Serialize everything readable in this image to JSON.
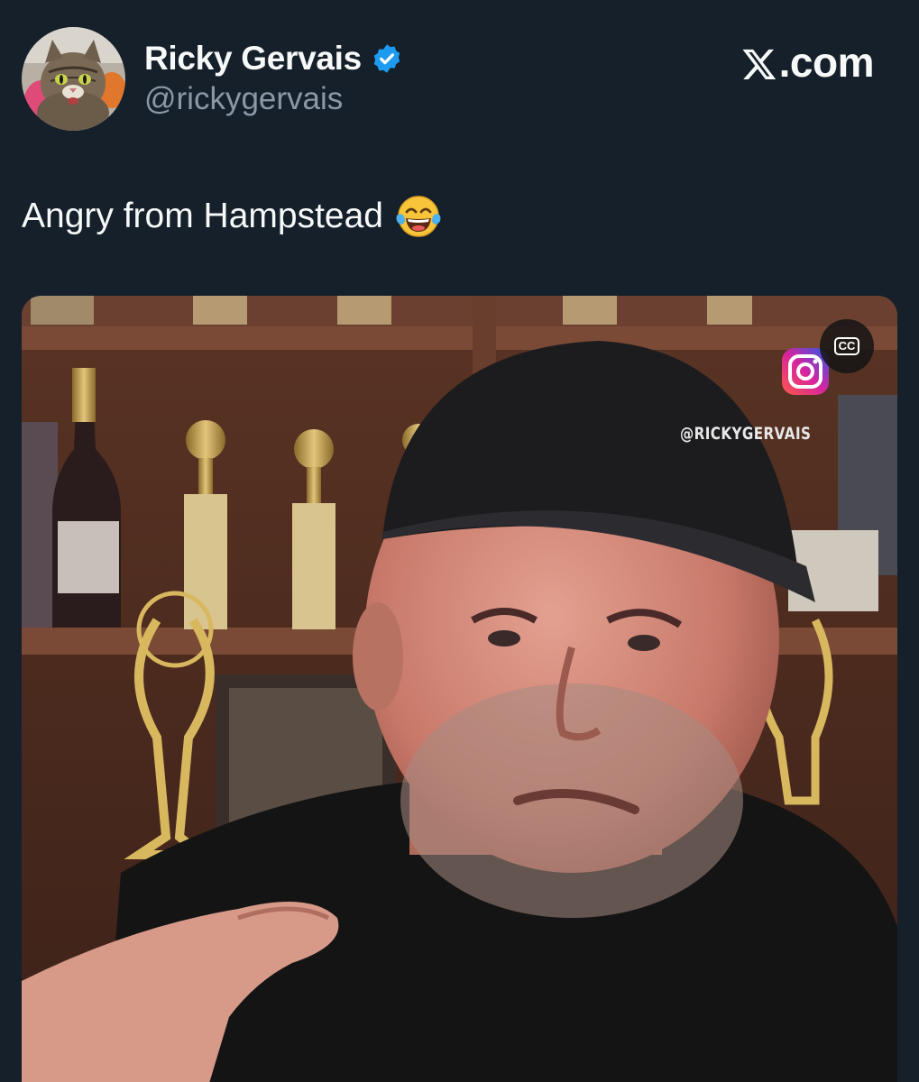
{
  "author": {
    "display_name": "Ricky Gervais",
    "handle": "@rickygervais",
    "verified": true,
    "avatar_icon": "cat-avatar"
  },
  "site": {
    "label": ".com",
    "logo_icon": "x-logo-icon"
  },
  "tweet": {
    "text": "Angry from Hampstead",
    "emoji": "face-with-tears-of-joy"
  },
  "media": {
    "type": "video",
    "watermark": "@RICKYGERVAIS",
    "captions_label": "CC",
    "platform_icon": "instagram-icon"
  },
  "colors": {
    "background": "#15202b",
    "verified": "#1d9bf0",
    "handle": "#8b98a5"
  }
}
